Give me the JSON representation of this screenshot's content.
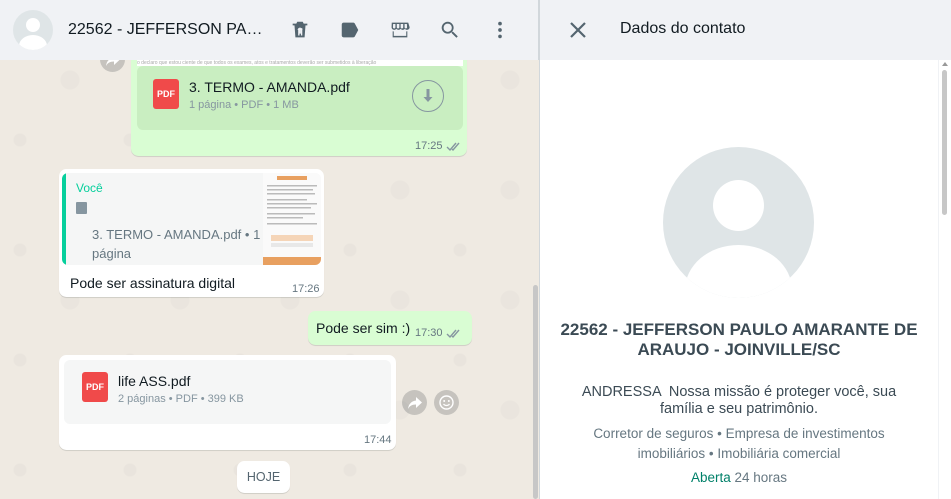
{
  "chat": {
    "title": "22562 - JEFFERSON PAUL...",
    "icons": [
      "delete-icon",
      "label-icon",
      "store-icon",
      "search-icon",
      "menu-icon"
    ],
    "preview_strip_text": "o declaro que estou ciente de que todos os exames, atos e tratamentos deverão ser submetidos à liberação",
    "messages": {
      "m1": {
        "doc_name": "3. TERMO - AMANDA.pdf",
        "doc_meta": "1 página • PDF • 1 MB",
        "time": "17:25",
        "pdf_label": "PDF"
      },
      "m2": {
        "reply_author": "Você",
        "reply_text": "3. TERMO - AMANDA.pdf • 1 página",
        "text": "Pode ser assinatura digital",
        "time": "17:26"
      },
      "m3": {
        "text": "Pode ser sim :)",
        "time": "17:30"
      },
      "m4": {
        "doc_name": "life ASS.pdf",
        "doc_meta": "2 páginas • PDF • 399 KB",
        "time": "17:44",
        "pdf_label": "PDF"
      }
    },
    "date_divider": "HOJE"
  },
  "contact": {
    "header_title": "Dados do contato",
    "name": "22562 - JEFFERSON PAULO AMARANTE DE ARAUJO - JOINVILLE/SC",
    "about": "ANDRESSA  Nossa missão é proteger você, sua família e seu patrimônio.",
    "categories": "Corretor de seguros • Empresa de investimentos imobiliários • Imobiliária comercial",
    "hours_status": "Aberta",
    "hours_detail": "24 horas"
  },
  "colors": {
    "outgoing_bubble": "#d9fdd3",
    "incoming_bubble": "#ffffff",
    "accent_green": "#008069",
    "reply_accent": "#06cf9c",
    "pdf_red": "#f04a4a",
    "read_ticks": "#53bdeb"
  }
}
